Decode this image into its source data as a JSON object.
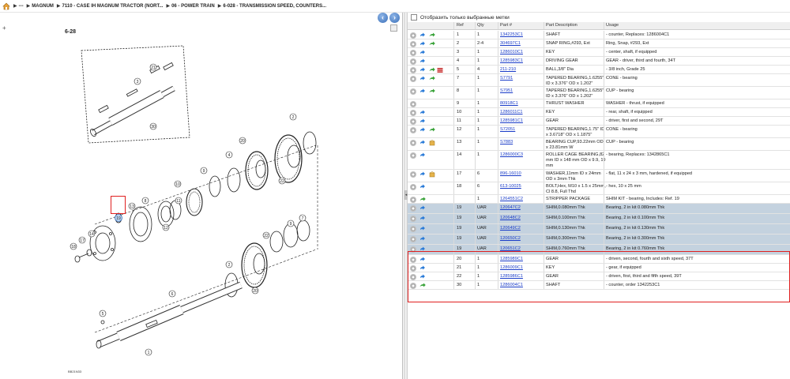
{
  "breadcrumb": {
    "items": [
      "---",
      "MAGNUM",
      "7110 - CASE IH MAGNUM TRACTOR (NORT...",
      "06 - POWER TRAIN",
      "6-028 - TRANSMISSION SPEED, COUNTERS..."
    ]
  },
  "diagram": {
    "page_label": "6-28",
    "footer_code": "BB21N33",
    "callouts": [
      "1",
      "2",
      "3",
      "4",
      "5",
      "6",
      "7",
      "8",
      "9",
      "10",
      "11",
      "12",
      "13",
      "14",
      "17",
      "18",
      "19",
      "20",
      "21",
      "22",
      "30"
    ]
  },
  "filter": {
    "checkbox_label": "Отобразить только выбранные метки",
    "checked": false
  },
  "table": {
    "headers": {
      "ref": "Ref",
      "qty": "Qty",
      "part": "Part #",
      "desc": "Part Description",
      "usage": "Usage"
    },
    "rows": [
      {
        "ref": "1",
        "qty": "1",
        "part": "1342253C1",
        "desc": "SHAFT",
        "usage": "- counter, Replaces: 1286004C1",
        "icons": [
          "gear",
          "link",
          "cart"
        ],
        "highlight": false
      },
      {
        "ref": "2",
        "qty": "2-4",
        "part": "304697C1",
        "desc": "SNAP RING,#293, Ext",
        "usage": "Ring, Snap, #293, Ext",
        "icons": [
          "gear",
          "link",
          "cart"
        ],
        "highlight": false
      },
      {
        "ref": "3",
        "qty": "1",
        "part": "1286010C1",
        "desc": "KEY",
        "usage": "- center, shaft, if equipped",
        "icons": [
          "gear",
          "link"
        ],
        "highlight": false
      },
      {
        "ref": "4",
        "qty": "1",
        "part": "1285983C1",
        "desc": "DRIVING GEAR",
        "usage": "GEAR - driver, third and fourth, 34T",
        "icons": [
          "gear",
          "link"
        ],
        "highlight": false
      },
      {
        "ref": "5",
        "qty": "4",
        "part": "211-210",
        "desc": "BALL,3/8\" Dia",
        "usage": "- 3/8 inch, Grade 25",
        "icons": [
          "gear",
          "link",
          "cart",
          "flag"
        ],
        "highlight": false
      },
      {
        "ref": "7",
        "qty": "1",
        "part": "S7791",
        "desc": "TAPERED BEARING,1.6255\" ID x 3.376\" OD x 1.202\"",
        "usage": "CONE - bearing",
        "icons": [
          "gear",
          "link",
          "cart"
        ],
        "highlight": false
      },
      {
        "ref": "8",
        "qty": "1",
        "part": "S7951",
        "desc": "TAPERED BEARING,1.6255\" ID x 3.376\" OD x 1.202\"",
        "usage": "CUP - bearing",
        "icons": [
          "gear",
          "link",
          "cart"
        ],
        "highlight": false
      },
      {
        "ref": "9",
        "qty": "1",
        "part": "80918C1",
        "desc": "THRUST WASHER",
        "usage": "WASHER - thrust, if equipped",
        "icons": [
          "gear"
        ],
        "highlight": false
      },
      {
        "ref": "10",
        "qty": "1",
        "part": "1286011C1",
        "desc": "KEY",
        "usage": "- rear, shaft, if equipped",
        "icons": [
          "gear",
          "link"
        ],
        "highlight": false
      },
      {
        "ref": "11",
        "qty": "1",
        "part": "1285981C1",
        "desc": "GEAR",
        "usage": "- driver, first and second, 29T",
        "icons": [
          "gear",
          "link"
        ],
        "highlight": false
      },
      {
        "ref": "12",
        "qty": "1",
        "part": "S72051",
        "desc": "TAPERED BEARING,1.75\" ID x 3.6718\" OD x 1.1875\"",
        "usage": "CONE - bearing",
        "icons": [
          "gear",
          "link",
          "cart"
        ],
        "highlight": false
      },
      {
        "ref": "13",
        "qty": "1",
        "part": "S7883",
        "desc": "BEARING CUP,93.22mm OD x 23.81mm W",
        "usage": "CUP - bearing",
        "icons": [
          "gear",
          "link",
          "box"
        ],
        "highlight": false
      },
      {
        "ref": "14",
        "qty": "1",
        "part": "1286000C3",
        "desc": "ROLLER CAGE BEARING,82 mm ID x 148 mm OD x 9.9, 19 mm",
        "usage": "- bearing, Replaces: 1342865C1",
        "icons": [
          "gear",
          "link"
        ],
        "highlight": false
      },
      {
        "ref": "17",
        "qty": "6",
        "part": "896-16010",
        "desc": "WASHER,11mm ID x 24mm OD x 3mm Thk",
        "usage": "- flat, 11 x 24 x 3 mm, hardened, if equipped",
        "icons": [
          "gear",
          "link",
          "box"
        ],
        "highlight": false
      },
      {
        "ref": "18",
        "qty": "6",
        "part": "613-10025",
        "desc": "BOLT,Hex, M10 x 1.5 x 25mm, Cl 8.8, Full Thd",
        "usage": "- hex, 10 x 25 mm",
        "icons": [
          "gear",
          "link"
        ],
        "highlight": false
      },
      {
        "ref": "",
        "qty": "1",
        "part": "1264551C2",
        "desc": "STRIPPER PACKAGE",
        "usage": "SHIM KIT - bearing, Includes: Ref. 19",
        "icons": [
          "gear",
          "cart"
        ],
        "highlight": false
      },
      {
        "ref": "19",
        "qty": "UAR",
        "part": "120647C2",
        "desc": "SHIM,0.080mm Thk",
        "usage": "Bearing, 2 in kit 0.080mm Thk",
        "icons": [
          "gear",
          "link"
        ],
        "highlight": true
      },
      {
        "ref": "19",
        "qty": "UAR",
        "part": "120648C2",
        "desc": "SHIM,0.100mm Thk",
        "usage": "Bearing, 2 in kit 0.100mm Thk",
        "icons": [
          "gear",
          "link"
        ],
        "highlight": true
      },
      {
        "ref": "19",
        "qty": "UAR",
        "part": "120649C2",
        "desc": "SHIM,0.130mm Thk",
        "usage": "Bearing, 2 in kit 0.130mm Thk",
        "icons": [
          "gear",
          "link"
        ],
        "highlight": true
      },
      {
        "ref": "19",
        "qty": "UAR",
        "part": "120650C2",
        "desc": "SHIM,0.300mm Thk",
        "usage": "Bearing, 2 in kit 0.300mm Thk",
        "icons": [
          "gear",
          "link"
        ],
        "highlight": true
      },
      {
        "ref": "19",
        "qty": "UAR",
        "part": "120651C2",
        "desc": "SHIM,0.760mm Thk",
        "usage": "Bearing, 2 in kit 0.760mm Thk",
        "icons": [
          "gear",
          "link"
        ],
        "highlight": true
      },
      {
        "ref": "20",
        "qty": "1",
        "part": "1285989C1",
        "desc": "GEAR",
        "usage": "- driven, second, fourth and sixth speed, 37T",
        "icons": [
          "gear",
          "link"
        ],
        "highlight": false
      },
      {
        "ref": "21",
        "qty": "1",
        "part": "1286009C1",
        "desc": "KEY",
        "usage": "- gear, if equipped",
        "icons": [
          "gear",
          "link"
        ],
        "highlight": false
      },
      {
        "ref": "22",
        "qty": "1",
        "part": "1285986C1",
        "desc": "GEAR",
        "usage": "- driven, first, third and fifth speed, 39T",
        "icons": [
          "gear",
          "link"
        ],
        "highlight": false
      },
      {
        "ref": "30",
        "qty": "1",
        "part": "1286004C1",
        "desc": "SHAFT",
        "usage": "- counter, order 1342253C1",
        "icons": [
          "gear",
          "cart"
        ],
        "highlight": false
      }
    ]
  },
  "colors": {
    "link": "#1a3cc8",
    "highlight_row": "#c4d2df",
    "highlight_border": "#e02020",
    "cart_green": "#3aa33a",
    "link_blue": "#2a7bd8"
  }
}
